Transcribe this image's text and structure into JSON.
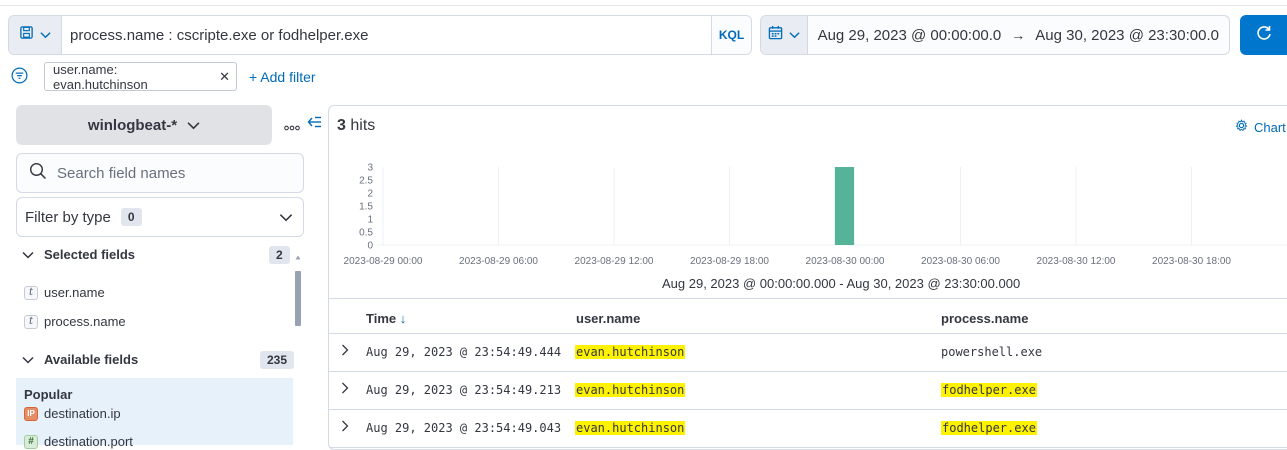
{
  "query": {
    "text": "process.name : cscripte.exe or fodhelper.exe",
    "language": "KQL"
  },
  "date_range": {
    "start": "Aug 29, 2023 @ 00:00:00.0",
    "end": "Aug 30, 2023 @ 23:30:00.0",
    "arrow": "→"
  },
  "filters": {
    "pill_label": "user.name: evan.hutchinson",
    "add_label": "+ Add filter"
  },
  "sidebar": {
    "index_pattern": "winlogbeat-*",
    "search_placeholder": "Search field names",
    "filter_by_type_label": "Filter by type",
    "filter_by_type_count": "0",
    "selected_label": "Selected fields",
    "selected_count": "2",
    "selected_fields": [
      {
        "type": "t",
        "name": "user.name"
      },
      {
        "type": "t",
        "name": "process.name"
      }
    ],
    "available_label": "Available fields",
    "available_count": "235",
    "popular_label": "Popular",
    "popular_fields": [
      {
        "type": "IP",
        "name": "destination.ip"
      },
      {
        "type": "#",
        "name": "destination.port"
      }
    ]
  },
  "hits": {
    "count": "3",
    "label": "hits"
  },
  "chart_options_label": "Chart",
  "chart_data": {
    "type": "bar",
    "x_ticks": [
      "2023-08-29 00:00",
      "2023-08-29 06:00",
      "2023-08-29 12:00",
      "2023-08-29 18:00",
      "2023-08-30 00:00",
      "2023-08-30 06:00",
      "2023-08-30 12:00",
      "2023-08-30 18:00"
    ],
    "y_ticks": [
      "3",
      "2.5",
      "2",
      "1.5",
      "1",
      "0.5",
      "0"
    ],
    "ylim": [
      0,
      3
    ],
    "bars": [
      {
        "x": "2023-08-29 23:30",
        "value": 3
      }
    ],
    "bar_color": "#54b399",
    "range_label": "Aug 29, 2023 @ 00:00:00.000 - Aug 30, 2023 @ 23:30:00.000"
  },
  "table": {
    "headers": {
      "time": "Time",
      "user": "user.name",
      "process": "process.name"
    },
    "sort_arrow": "↓",
    "rows": [
      {
        "time": "Aug 29, 2023 @ 23:54:49.444",
        "user": "evan.hutchinson",
        "process": "powershell.exe",
        "process_highlight": false
      },
      {
        "time": "Aug 29, 2023 @ 23:54:49.213",
        "user": "evan.hutchinson",
        "process": "fodhelper.exe",
        "process_highlight": true
      },
      {
        "time": "Aug 29, 2023 @ 23:54:49.043",
        "user": "evan.hutchinson",
        "process": "fodhelper.exe",
        "process_highlight": true
      }
    ]
  },
  "colors": {
    "accent": "#006bb8",
    "highlight": "#fff200",
    "primary_button": "#0077cc"
  }
}
